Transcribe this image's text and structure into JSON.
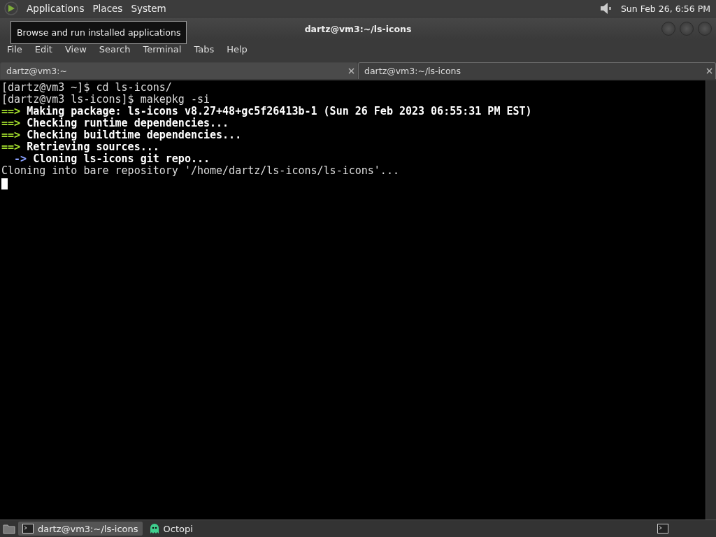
{
  "top_panel": {
    "menus": [
      "Applications",
      "Places",
      "System"
    ],
    "clock": "Sun Feb 26,  6:56 PM"
  },
  "tooltip": {
    "text": "Browse and run installed applications"
  },
  "window": {
    "title": "dartz@vm3:~/ls-icons"
  },
  "menubar": [
    "File",
    "Edit",
    "View",
    "Search",
    "Terminal",
    "Tabs",
    "Help"
  ],
  "tabs": [
    {
      "label": "dartz@vm3:~",
      "selected": false
    },
    {
      "label": "dartz@vm3:~/ls-icons",
      "selected": true
    }
  ],
  "terminal": {
    "lines": [
      {
        "kind": "plain",
        "text": "[dartz@vm3 ~]$ cd ls-icons/"
      },
      {
        "kind": "plain",
        "text": "[dartz@vm3 ls-icons]$ makepkg -si"
      },
      {
        "kind": "step",
        "marker": "==>",
        "text": "Making package: ls-icons v8.27+48+gc5f26413b-1 (Sun 26 Feb 2023 06:55:31 PM EST)"
      },
      {
        "kind": "step",
        "marker": "==>",
        "text": "Checking runtime dependencies..."
      },
      {
        "kind": "step",
        "marker": "==>",
        "text": "Checking buildtime dependencies..."
      },
      {
        "kind": "step",
        "marker": "==>",
        "text": "Retrieving sources..."
      },
      {
        "kind": "substep",
        "marker": "->",
        "text": "Cloning ls-icons git repo..."
      },
      {
        "kind": "plain",
        "text": "Cloning into bare repository '/home/dartz/ls-icons/ls-icons'..."
      }
    ]
  },
  "taskbar": {
    "tasks": [
      {
        "label": "dartz@vm3:~/ls-icons",
        "kind": "terminal",
        "selected": true
      },
      {
        "label": "Octopi",
        "kind": "ghost",
        "selected": false
      }
    ]
  }
}
